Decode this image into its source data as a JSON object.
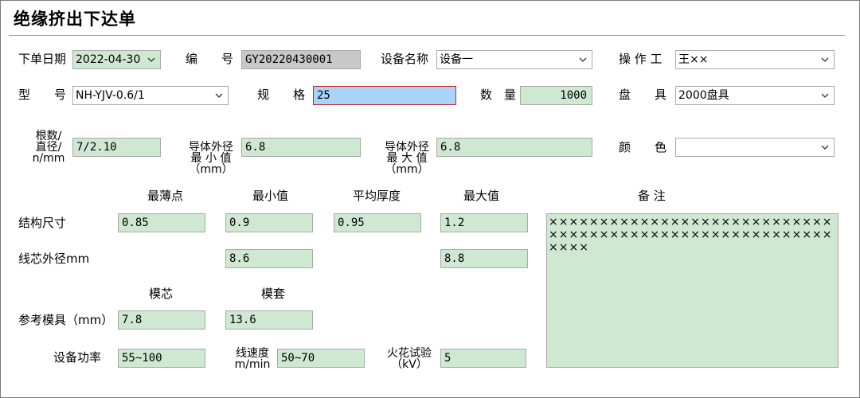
{
  "title": "绝缘挤出下达单",
  "order_date": {
    "label": "下单日期",
    "value": "2022-04-30"
  },
  "number": {
    "label": "编　　号",
    "value": "GY20220430001"
  },
  "device_name": {
    "label": "设备名称",
    "value": "设备一"
  },
  "operator": {
    "label": "操 作 工",
    "value": "王××"
  },
  "model": {
    "label": "型　　号",
    "value": "NH-YJV-0.6/1"
  },
  "spec": {
    "label": "规　　格",
    "value": "25"
  },
  "quantity": {
    "label": "数　量",
    "value": "1000"
  },
  "reel": {
    "label": "盘　　具",
    "value": "2000盘具"
  },
  "strands": {
    "label_l1": "根数/",
    "label_l2": "直径/",
    "label_l3": "n/mm",
    "value": "7/2.10"
  },
  "cond_min": {
    "label_l1": "导体外径",
    "label_l2": "最 小 值",
    "label_l3": "（mm）",
    "value": "6.8"
  },
  "cond_max": {
    "label_l1": "导体外径",
    "label_l2": "最 大 值",
    "label_l3": "（mm）",
    "value": "6.8"
  },
  "color": {
    "label": "颜　　色",
    "value": ""
  },
  "col_headers": {
    "thinnest": "最薄点",
    "min": "最小值",
    "avg": "平均厚度",
    "max": "最大值",
    "remark": "备 注"
  },
  "structure": {
    "label": "结构尺寸",
    "thinnest": "0.85",
    "min": "0.9",
    "avg": "0.95",
    "max": "1.2"
  },
  "core_od": {
    "label": "线芯外径mm",
    "min": "8.6",
    "max": "8.8"
  },
  "die_headers": {
    "core": "模芯",
    "sleeve": "模套"
  },
  "ref_die": {
    "label": "参考模具（mm）",
    "core": "7.8",
    "sleeve": "13.6"
  },
  "power": {
    "label": "设备功率",
    "value": "55~100"
  },
  "line_speed": {
    "label_l1": "线速度",
    "label_l2": "m/min",
    "value": "50~70"
  },
  "spark_test": {
    "label_l1": "火花试验",
    "label_l2": "（kV）",
    "value": "5"
  },
  "remark": "××××××××××××××××××××××××××××××××××××××××××××××××××××××××××××"
}
